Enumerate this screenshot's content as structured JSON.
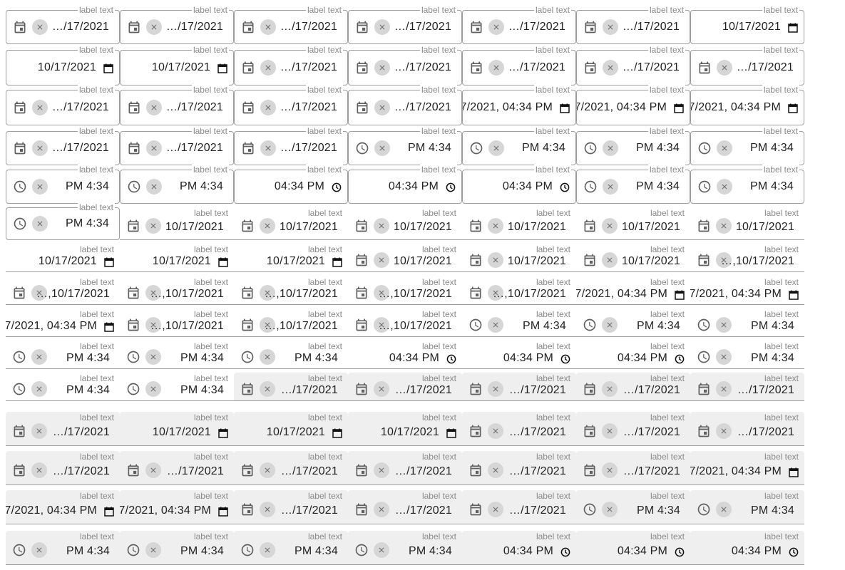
{
  "field_label": "label text",
  "values": {
    "d_trunc": "…/17/2021",
    "d_full": "10/17/2021",
    "d_multi": "…,10/17/2021",
    "dt_partial": "7/2021, 04:34 PM",
    "t12": "PM 4:34",
    "t_native": "04:34 PM"
  },
  "icons": {
    "calendar": "calendar-icon",
    "clock": "clock-icon",
    "clear": "clear-icon",
    "calendar_native": "native-calendar-icon",
    "clock_native": "native-clock-icon"
  },
  "colors": {
    "outline": "#9e9e9e",
    "label": "#8a8a8a",
    "icon": "#5f5f5f",
    "clear_bg": "#d6d6d6",
    "filled_bg": "#efefef"
  },
  "rows": [
    {
      "variant": "outlined",
      "fields": [
        {
          "lead": "calendar",
          "clear": true,
          "value": "d_trunc"
        },
        {
          "lead": "calendar",
          "clear": true,
          "value": "d_trunc"
        },
        {
          "lead": "calendar",
          "clear": true,
          "value": "d_trunc"
        },
        {
          "lead": "calendar",
          "clear": true,
          "value": "d_trunc"
        },
        {
          "lead": "calendar",
          "clear": true,
          "value": "d_trunc"
        },
        {
          "lead": "calendar",
          "clear": true,
          "value": "d_trunc"
        },
        {
          "value": "d_full",
          "trail": "calendar_native"
        }
      ]
    },
    {
      "variant": "outlined",
      "fields": [
        {
          "value": "d_full",
          "trail": "calendar_native"
        },
        {
          "value": "d_full",
          "trail": "calendar_native"
        },
        {
          "lead": "calendar",
          "clear": true,
          "value": "d_trunc"
        },
        {
          "lead": "calendar",
          "clear": true,
          "value": "d_trunc"
        },
        {
          "lead": "calendar",
          "clear": true,
          "value": "d_trunc"
        },
        {
          "lead": "calendar",
          "clear": true,
          "value": "d_trunc"
        },
        {
          "lead": "calendar",
          "clear": true,
          "value": "d_trunc"
        }
      ]
    },
    {
      "variant": "outlined",
      "fields": [
        {
          "lead": "calendar",
          "clear": true,
          "value": "d_trunc"
        },
        {
          "lead": "calendar",
          "clear": true,
          "value": "d_trunc"
        },
        {
          "lead": "calendar",
          "clear": true,
          "value": "d_trunc"
        },
        {
          "lead": "calendar",
          "clear": true,
          "value": "d_trunc"
        },
        {
          "value": "dt_partial",
          "trail": "calendar_native"
        },
        {
          "value": "dt_partial",
          "trail": "calendar_native"
        },
        {
          "value": "dt_partial",
          "trail": "calendar_native"
        }
      ]
    },
    {
      "variant": "outlined",
      "fields": [
        {
          "lead": "calendar",
          "clear": true,
          "value": "d_trunc"
        },
        {
          "lead": "calendar",
          "clear": true,
          "value": "d_trunc"
        },
        {
          "lead": "calendar",
          "clear": true,
          "value": "d_trunc"
        },
        {
          "lead": "clock",
          "clear": true,
          "value": "t12"
        },
        {
          "lead": "clock",
          "clear": true,
          "value": "t12"
        },
        {
          "lead": "clock",
          "clear": true,
          "value": "t12"
        },
        {
          "lead": "clock",
          "clear": true,
          "value": "t12"
        }
      ]
    },
    {
      "variant": "outlined",
      "fields": [
        {
          "lead": "clock",
          "clear": true,
          "value": "t12"
        },
        {
          "lead": "clock",
          "clear": true,
          "value": "t12"
        },
        {
          "value": "t_native",
          "trail": "clock_native"
        },
        {
          "value": "t_native",
          "trail": "clock_native"
        },
        {
          "value": "t_native",
          "trail": "clock_native"
        },
        {
          "lead": "clock",
          "clear": true,
          "value": "t12"
        },
        {
          "lead": "clock",
          "clear": true,
          "value": "t12"
        }
      ]
    },
    {
      "variant": "mixed",
      "fields": [
        {
          "lead": "clock",
          "clear": true,
          "value": "t12",
          "variant": "outlined"
        },
        {
          "lead": "calendar",
          "clear": true,
          "value": "d_full",
          "variant": "underlined"
        },
        {
          "lead": "calendar",
          "clear": true,
          "value": "d_full",
          "variant": "underlined"
        },
        {
          "lead": "calendar",
          "clear": true,
          "value": "d_full",
          "variant": "underlined"
        },
        {
          "lead": "calendar",
          "clear": true,
          "value": "d_full",
          "variant": "underlined"
        },
        {
          "lead": "calendar",
          "clear": true,
          "value": "d_full",
          "variant": "underlined"
        },
        {
          "lead": "calendar",
          "clear": true,
          "value": "d_full",
          "variant": "underlined"
        }
      ]
    },
    {
      "variant": "underlined",
      "fields": [
        {
          "value": "d_full",
          "trail": "calendar_native"
        },
        {
          "value": "d_full",
          "trail": "calendar_native"
        },
        {
          "value": "d_full",
          "trail": "calendar_native"
        },
        {
          "lead": "calendar",
          "clear": true,
          "value": "d_full"
        },
        {
          "lead": "calendar",
          "clear": true,
          "value": "d_full"
        },
        {
          "lead": "calendar",
          "clear": true,
          "value": "d_full"
        },
        {
          "lead": "calendar",
          "clear": true,
          "value": "d_multi"
        }
      ]
    },
    {
      "variant": "underlined",
      "fields": [
        {
          "lead": "calendar",
          "clear": true,
          "value": "d_multi"
        },
        {
          "lead": "calendar",
          "clear": true,
          "value": "d_multi"
        },
        {
          "lead": "calendar",
          "clear": true,
          "value": "d_multi"
        },
        {
          "lead": "calendar",
          "clear": true,
          "value": "d_multi"
        },
        {
          "lead": "calendar",
          "clear": true,
          "value": "d_multi"
        },
        {
          "value": "dt_partial",
          "trail": "calendar_native"
        },
        {
          "value": "dt_partial",
          "trail": "calendar_native"
        }
      ]
    },
    {
      "variant": "underlined",
      "fields": [
        {
          "value": "dt_partial",
          "trail": "calendar_native"
        },
        {
          "lead": "calendar",
          "clear": true,
          "value": "d_multi"
        },
        {
          "lead": "calendar",
          "clear": true,
          "value": "d_multi"
        },
        {
          "lead": "calendar",
          "clear": true,
          "value": "d_multi"
        },
        {
          "lead": "clock",
          "clear": true,
          "value": "t12"
        },
        {
          "lead": "clock",
          "clear": true,
          "value": "t12"
        },
        {
          "lead": "clock",
          "clear": true,
          "value": "t12"
        }
      ]
    },
    {
      "variant": "underlined",
      "fields": [
        {
          "lead": "clock",
          "clear": true,
          "value": "t12"
        },
        {
          "lead": "clock",
          "clear": true,
          "value": "t12"
        },
        {
          "lead": "clock",
          "clear": true,
          "value": "t12"
        },
        {
          "value": "t_native",
          "trail": "clock_native"
        },
        {
          "value": "t_native",
          "trail": "clock_native"
        },
        {
          "value": "t_native",
          "trail": "clock_native"
        },
        {
          "lead": "clock",
          "clear": true,
          "value": "t12"
        }
      ]
    },
    {
      "variant": "mixed",
      "fields": [
        {
          "lead": "clock",
          "clear": true,
          "value": "t12",
          "variant": "underlined"
        },
        {
          "lead": "clock",
          "clear": true,
          "value": "t12",
          "variant": "underlined"
        },
        {
          "lead": "calendar",
          "clear": true,
          "value": "d_trunc",
          "variant": "filled"
        },
        {
          "lead": "calendar",
          "clear": true,
          "value": "d_trunc",
          "variant": "filled"
        },
        {
          "lead": "calendar",
          "clear": true,
          "value": "d_trunc",
          "variant": "filled"
        },
        {
          "lead": "calendar",
          "clear": true,
          "value": "d_trunc",
          "variant": "filled"
        },
        {
          "lead": "calendar",
          "clear": true,
          "value": "d_trunc",
          "variant": "filled"
        }
      ]
    },
    {
      "variant": "filled",
      "fields": [
        {
          "lead": "calendar",
          "clear": true,
          "value": "d_trunc"
        },
        {
          "value": "d_full",
          "trail": "calendar_native"
        },
        {
          "value": "d_full",
          "trail": "calendar_native"
        },
        {
          "value": "d_full",
          "trail": "calendar_native"
        },
        {
          "lead": "calendar",
          "clear": true,
          "value": "d_trunc"
        },
        {
          "lead": "calendar",
          "clear": true,
          "value": "d_trunc"
        },
        {
          "lead": "calendar",
          "clear": true,
          "value": "d_trunc"
        }
      ]
    },
    {
      "variant": "filled",
      "fields": [
        {
          "lead": "calendar",
          "clear": true,
          "value": "d_trunc"
        },
        {
          "lead": "calendar",
          "clear": true,
          "value": "d_trunc"
        },
        {
          "lead": "calendar",
          "clear": true,
          "value": "d_trunc"
        },
        {
          "lead": "calendar",
          "clear": true,
          "value": "d_trunc"
        },
        {
          "lead": "calendar",
          "clear": true,
          "value": "d_trunc"
        },
        {
          "lead": "calendar",
          "clear": true,
          "value": "d_trunc"
        },
        {
          "value": "dt_partial",
          "trail": "calendar_native"
        }
      ]
    },
    {
      "variant": "filled",
      "fields": [
        {
          "value": "dt_partial",
          "trail": "calendar_native"
        },
        {
          "value": "dt_partial",
          "trail": "calendar_native"
        },
        {
          "lead": "calendar",
          "clear": true,
          "value": "d_trunc"
        },
        {
          "lead": "calendar",
          "clear": true,
          "value": "d_trunc"
        },
        {
          "lead": "calendar",
          "clear": true,
          "value": "d_trunc"
        },
        {
          "lead": "clock",
          "clear": true,
          "value": "t12"
        },
        {
          "lead": "clock",
          "clear": true,
          "value": "t12"
        }
      ]
    },
    {
      "variant": "filled",
      "fields": [
        {
          "lead": "clock",
          "clear": true,
          "value": "t12"
        },
        {
          "lead": "clock",
          "clear": true,
          "value": "t12"
        },
        {
          "lead": "clock",
          "clear": true,
          "value": "t12"
        },
        {
          "lead": "clock",
          "clear": true,
          "value": "t12"
        },
        {
          "value": "t_native",
          "trail": "clock_native"
        },
        {
          "value": "t_native",
          "trail": "clock_native"
        },
        {
          "value": "t_native",
          "trail": "clock_native"
        }
      ]
    }
  ]
}
